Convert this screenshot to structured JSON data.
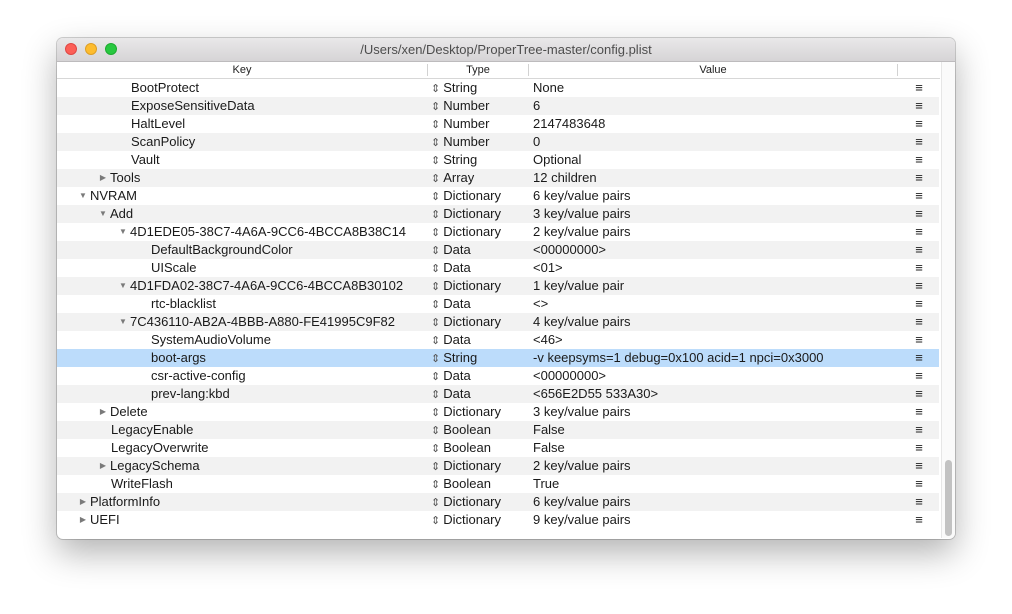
{
  "window": {
    "title": "/Users/xen/Desktop/ProperTree-master/config.plist"
  },
  "columns": {
    "key": "Key",
    "type": "Type",
    "value": "Value"
  },
  "rows": [
    {
      "key": "BootProtect",
      "indent": 3,
      "expander": "none",
      "type": "String",
      "value": "None"
    },
    {
      "key": "ExposeSensitiveData",
      "indent": 3,
      "expander": "none",
      "type": "Number",
      "value": "6"
    },
    {
      "key": "HaltLevel",
      "indent": 3,
      "expander": "none",
      "type": "Number",
      "value": "2147483648"
    },
    {
      "key": "ScanPolicy",
      "indent": 3,
      "expander": "none",
      "type": "Number",
      "value": "0"
    },
    {
      "key": "Vault",
      "indent": 3,
      "expander": "none",
      "type": "String",
      "value": "Optional"
    },
    {
      "key": "Tools",
      "indent": 2,
      "expander": "collapsed",
      "type": "Array",
      "value": "12 children"
    },
    {
      "key": "NVRAM",
      "indent": 1,
      "expander": "expanded",
      "type": "Dictionary",
      "value": "6 key/value pairs"
    },
    {
      "key": "Add",
      "indent": 2,
      "expander": "expanded",
      "type": "Dictionary",
      "value": "3 key/value pairs"
    },
    {
      "key": "4D1EDE05-38C7-4A6A-9CC6-4BCCA8B38C14",
      "indent": 3,
      "expander": "expanded",
      "type": "Dictionary",
      "value": "2 key/value pairs"
    },
    {
      "key": "DefaultBackgroundColor",
      "indent": 4,
      "expander": "none",
      "type": "Data",
      "value": "<00000000>"
    },
    {
      "key": "UIScale",
      "indent": 4,
      "expander": "none",
      "type": "Data",
      "value": "<01>"
    },
    {
      "key": "4D1FDA02-38C7-4A6A-9CC6-4BCCA8B30102",
      "indent": 3,
      "expander": "expanded",
      "type": "Dictionary",
      "value": "1 key/value pair"
    },
    {
      "key": "rtc-blacklist",
      "indent": 4,
      "expander": "none",
      "type": "Data",
      "value": "<>"
    },
    {
      "key": "7C436110-AB2A-4BBB-A880-FE41995C9F82",
      "indent": 3,
      "expander": "expanded",
      "type": "Dictionary",
      "value": "4 key/value pairs"
    },
    {
      "key": "SystemAudioVolume",
      "indent": 4,
      "expander": "none",
      "type": "Data",
      "value": "<46>"
    },
    {
      "key": "boot-args",
      "indent": 4,
      "expander": "none",
      "type": "String",
      "value": "-v keepsyms=1 debug=0x100 acid=1 npci=0x3000",
      "selected": true
    },
    {
      "key": "csr-active-config",
      "indent": 4,
      "expander": "none",
      "type": "Data",
      "value": "<00000000>"
    },
    {
      "key": "prev-lang:kbd",
      "indent": 4,
      "expander": "none",
      "type": "Data",
      "value": "<656E2D55 533A30>"
    },
    {
      "key": "Delete",
      "indent": 2,
      "expander": "collapsed",
      "type": "Dictionary",
      "value": "3 key/value pairs"
    },
    {
      "key": "LegacyEnable",
      "indent": 2,
      "expander": "none",
      "type": "Boolean",
      "value": "False"
    },
    {
      "key": "LegacyOverwrite",
      "indent": 2,
      "expander": "none",
      "type": "Boolean",
      "value": "False"
    },
    {
      "key": "LegacySchema",
      "indent": 2,
      "expander": "collapsed",
      "type": "Dictionary",
      "value": "2 key/value pairs"
    },
    {
      "key": "WriteFlash",
      "indent": 2,
      "expander": "none",
      "type": "Boolean",
      "value": "True"
    },
    {
      "key": "PlatformInfo",
      "indent": 1,
      "expander": "collapsed",
      "type": "Dictionary",
      "value": "6 key/value pairs"
    },
    {
      "key": "UEFI",
      "indent": 1,
      "expander": "collapsed",
      "type": "Dictionary",
      "value": "9 key/value pairs"
    }
  ],
  "icons": {
    "updown": "updown-arrows-icon",
    "menu": "hamburger-menu-icon"
  }
}
